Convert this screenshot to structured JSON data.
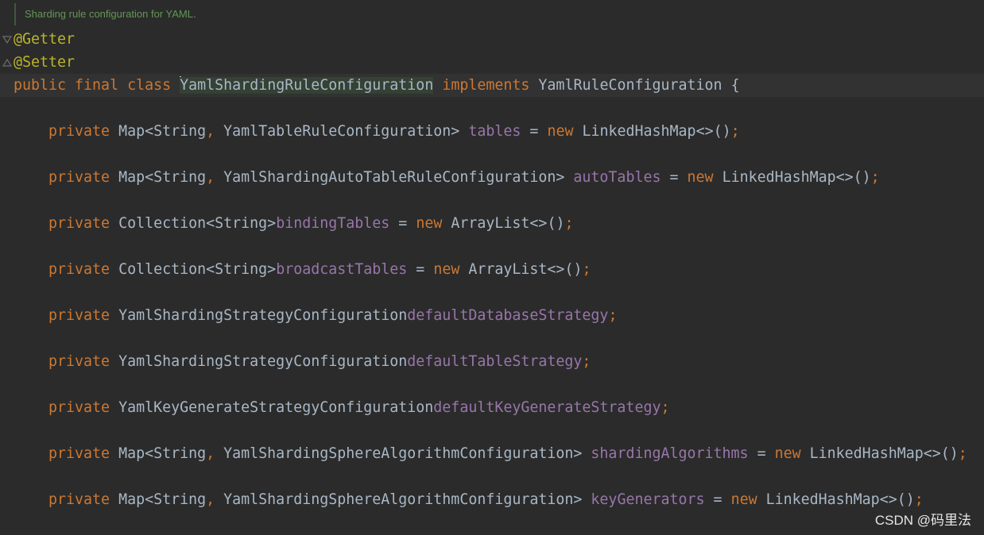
{
  "editor": {
    "doc_comment": "Sharding rule configuration for YAML.",
    "annotations": [
      "@Getter",
      "@Setter"
    ],
    "class_decl": {
      "modifiers": "public final class",
      "class_name": "YamlShardingRuleConfiguration",
      "implements_kw": "implements",
      "interface_name": "YamlRuleConfiguration",
      "open_brace": "{"
    },
    "fields": [
      {
        "modifier": "private",
        "type": "Map<String",
        "comma": ",",
        "type2": " YamlTableRuleConfiguration>",
        "name": "tables",
        "eq": "=",
        "new_kw": "new",
        "init": "LinkedHashMap<>()",
        "semi": ";"
      },
      {
        "modifier": "private",
        "type": "Map<String",
        "comma": ",",
        "type2": " YamlShardingAutoTableRuleConfiguration>",
        "name": "autoTables",
        "eq": "=",
        "new_kw": "new",
        "init": "LinkedHashMap<>()",
        "semi": ";"
      },
      {
        "modifier": "private",
        "type": "Collection<String>",
        "comma": "",
        "type2": "",
        "name": "bindingTables",
        "eq": "=",
        "new_kw": "new",
        "init": "ArrayList<>()",
        "semi": ";"
      },
      {
        "modifier": "private",
        "type": "Collection<String>",
        "comma": "",
        "type2": "",
        "name": "broadcastTables",
        "eq": "=",
        "new_kw": "new",
        "init": "ArrayList<>()",
        "semi": ";"
      },
      {
        "modifier": "private",
        "type": "YamlShardingStrategyConfiguration",
        "comma": "",
        "type2": "",
        "name": "defaultDatabaseStrategy",
        "eq": "",
        "new_kw": "",
        "init": "",
        "semi": ";"
      },
      {
        "modifier": "private",
        "type": "YamlShardingStrategyConfiguration",
        "comma": "",
        "type2": "",
        "name": "defaultTableStrategy",
        "eq": "",
        "new_kw": "",
        "init": "",
        "semi": ";"
      },
      {
        "modifier": "private",
        "type": "YamlKeyGenerateStrategyConfiguration",
        "comma": "",
        "type2": "",
        "name": "defaultKeyGenerateStrategy",
        "eq": "",
        "new_kw": "",
        "init": "",
        "semi": ";"
      },
      {
        "modifier": "private",
        "type": "Map<String",
        "comma": ",",
        "type2": " YamlShardingSphereAlgorithmConfiguration>",
        "name": "shardingAlgorithms",
        "eq": "=",
        "new_kw": "new",
        "init": "LinkedHashMap<>()",
        "semi": ";"
      },
      {
        "modifier": "private",
        "type": "Map<String",
        "comma": ",",
        "type2": " YamlShardingSphereAlgorithmConfiguration>",
        "name": "keyGenerators",
        "eq": "=",
        "new_kw": "new",
        "init": "LinkedHashMap<>()",
        "semi": ";"
      }
    ]
  },
  "watermark": "CSDN @码里法",
  "colors": {
    "background": "#2b2b2b",
    "keyword": "#cc7832",
    "annotation": "#bbb529",
    "field": "#9876aa",
    "text": "#a9b7c6",
    "doc_comment": "#629755"
  },
  "icons": [
    "fold-icon"
  ]
}
